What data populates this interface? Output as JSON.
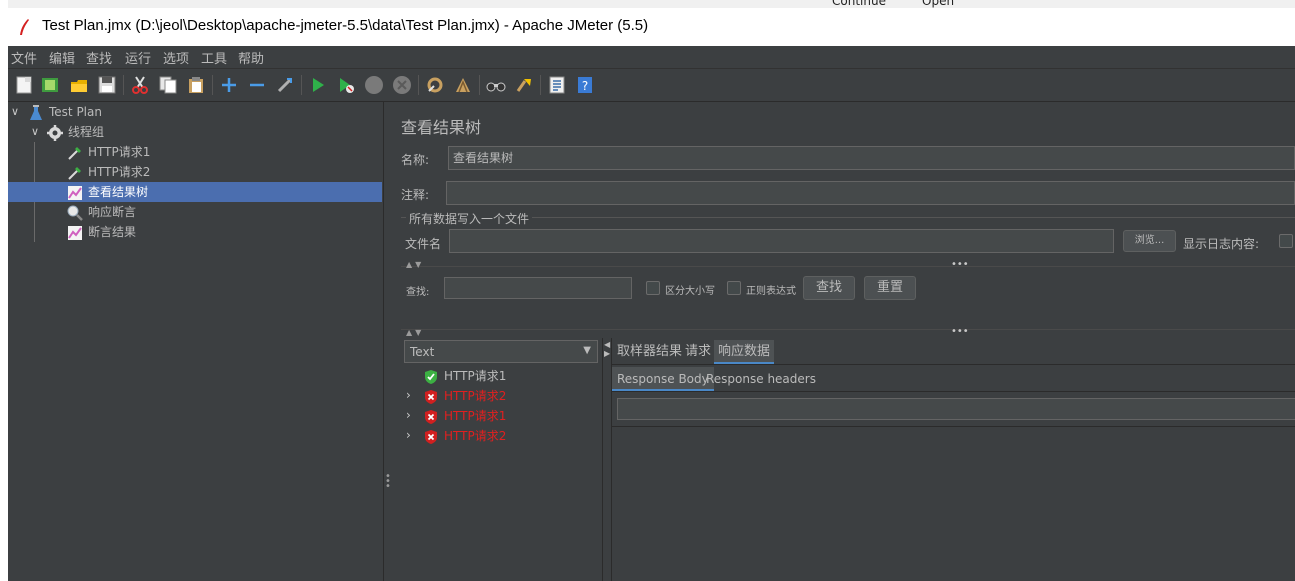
{
  "window": {
    "title": "Test Plan.jmx (D:\\jeol\\Desktop\\apache-jmeter-5.5\\data\\Test Plan.jmx) - Apache JMeter (5.5)",
    "background_fragments": [
      "Continue",
      "Open"
    ]
  },
  "menu": {
    "items": [
      "文件",
      "编辑",
      "查找",
      "运行",
      "选项",
      "工具",
      "帮助"
    ]
  },
  "toolbar": {
    "icons": [
      "new-icon",
      "templates-icon",
      "open-icon",
      "save-icon",
      "cut-icon",
      "copy-icon",
      "paste-icon",
      "expand-icon",
      "collapse-icon",
      "toggle-icon",
      "start-icon",
      "start-no-pause-icon",
      "stop-icon",
      "shutdown-icon",
      "clear-icon",
      "clear-all-icon",
      "search-icon",
      "reset-search-icon",
      "function-helper-icon",
      "help-icon"
    ]
  },
  "tree": {
    "nodes": [
      {
        "label": "Test Plan",
        "icon": "test-plan-flask-icon"
      },
      {
        "label": "线程组",
        "icon": "gear-icon"
      },
      {
        "label": "HTTP请求1",
        "icon": "pipette-icon"
      },
      {
        "label": "HTTP请求2",
        "icon": "pipette-icon"
      },
      {
        "label": "查看结果树",
        "icon": "graph-icon",
        "selected": true
      },
      {
        "label": "响应断言",
        "icon": "magnifier-icon"
      },
      {
        "label": "断言结果",
        "icon": "graph-icon"
      }
    ]
  },
  "panel": {
    "title": "查看结果树",
    "name_label": "名称:",
    "name_value": "查看结果树",
    "comment_label": "注释:",
    "comment_value": "",
    "file_group_label": "所有数据写入一个文件",
    "filename_label": "文件名",
    "filename_value": "",
    "browse_label": "浏览...",
    "log_label": "显示日志内容:",
    "search_label": "查找:",
    "search_value": "",
    "case_label": "区分大小写",
    "regex_label": "正则表达式",
    "find_button": "查找",
    "reset_button": "重置"
  },
  "results": {
    "renderer": "Text",
    "samples": [
      {
        "label": "HTTP请求1",
        "status": "success",
        "expandable": false
      },
      {
        "label": "HTTP请求2",
        "status": "failure",
        "expandable": true
      },
      {
        "label": "HTTP请求1",
        "status": "failure",
        "expandable": true
      },
      {
        "label": "HTTP请求2",
        "status": "failure",
        "expandable": true
      }
    ],
    "tabs": [
      "取样器结果",
      "请求",
      "响应数据"
    ],
    "active_tab": "响应数据",
    "subtabs": [
      "Response Body",
      "Response headers"
    ],
    "active_subtab": "Response Body",
    "response_search": ""
  },
  "colors": {
    "background": "#3c3f41",
    "selection": "#4b6eaf",
    "failure": "#e02020",
    "success": "#3cb043"
  }
}
